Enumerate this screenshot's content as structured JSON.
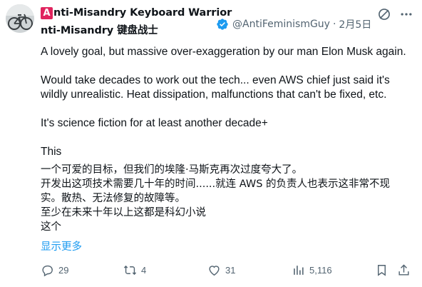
{
  "author": {
    "name_badge_letter": "A",
    "name_line1": "nti-Misandry Keyboard Warrior",
    "name_line2": "nti-Misandry 键盘战士",
    "handle": "@AntiFeminismGuy",
    "separator": "·",
    "date": "2月5日",
    "verified": true,
    "avatar_icon": "avatar-photo"
  },
  "top_icons": [
    "grok-icon",
    "more-icon"
  ],
  "content": {
    "paragraph1": "A lovely goal, but massive over-exaggeration by our man Elon Musk again.",
    "paragraph2_line1": "Would take decades to work out the tech... even AWS chief just said it's",
    "paragraph2_line2": "wildly unrealistic. Heat dissipation, malfunctions that can't be fixed, etc.",
    "paragraph3": "It's science fiction for at least another decade+",
    "paragraph4": "This",
    "translation_line1": "一个可爱的目标，但我们的埃隆·马斯克再次过度夸大了。",
    "translation_line2": "开发出这项技术需要几十年的时间......就连 AWS 的负责人也表示这非常不现",
    "translation_line3": "实。散热、无法修复的故障等。",
    "translation_line4": "至少在未来十年以上这都是科幻小说",
    "translation_line5": "这个"
  },
  "show_more_label": "显示更多",
  "actions": {
    "replies": "29",
    "reposts": "4",
    "likes": "31",
    "views": "5,116"
  },
  "colors": {
    "accent": "#1d9bf0",
    "muted": "#536471",
    "text": "#0f1419",
    "badge": "#e0245e"
  }
}
